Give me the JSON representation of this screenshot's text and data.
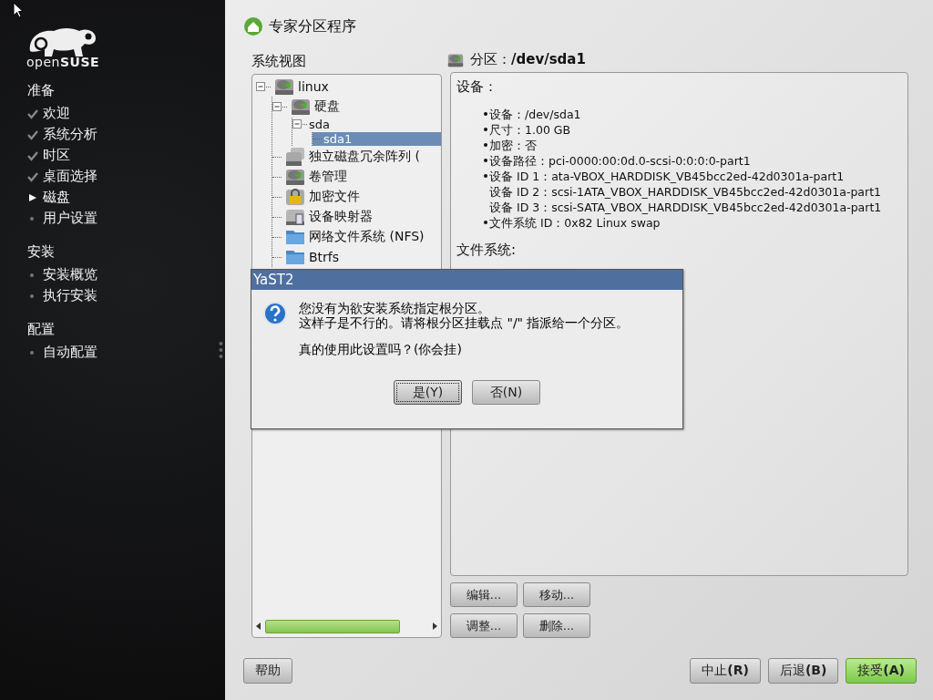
{
  "sidebar": {
    "logo_text": "open**SUSE**",
    "sections": [
      {
        "heading": "准备",
        "steps": [
          {
            "label": "欢迎",
            "completed": true,
            "current": false
          },
          {
            "label": "系统分析",
            "completed": true,
            "current": false
          },
          {
            "label": "时区",
            "completed": true,
            "current": false
          },
          {
            "label": "桌面选择",
            "completed": true,
            "current": false
          },
          {
            "label": "磁盘",
            "completed": false,
            "current": true
          },
          {
            "label": "用户设置",
            "completed": false,
            "current": false
          }
        ]
      },
      {
        "heading": "安装",
        "steps": [
          {
            "label": "安装概览",
            "completed": false,
            "current": false
          },
          {
            "label": "执行安装",
            "completed": false,
            "current": false
          }
        ]
      },
      {
        "heading": "配置",
        "steps": [
          {
            "label": "自动配置",
            "completed": false,
            "current": false
          }
        ]
      }
    ]
  },
  "header": {
    "title": "专家分区程序"
  },
  "system_view": {
    "label": "系统视图",
    "tree": [
      {
        "label": "linux",
        "kind": "disk",
        "selected": false,
        "expanded": true,
        "children": [
          {
            "label": "硬盘",
            "kind": "disk",
            "selected": false,
            "expanded": true,
            "children": [
              {
                "label": "sda",
                "selected": false,
                "expanded": true,
                "children": [
                  {
                    "label": "sda1",
                    "selected": true
                  }
                ]
              }
            ]
          },
          {
            "label": "独立磁盘冗余阵列 (",
            "kind": "raid",
            "selected": false
          },
          {
            "label": "卷管理",
            "kind": "disk",
            "selected": false
          },
          {
            "label": "加密文件",
            "kind": "lock",
            "selected": false
          },
          {
            "label": "设备映射器",
            "kind": "mapper",
            "selected": false
          },
          {
            "label": "网络文件系统 (NFS)",
            "kind": "folder",
            "selected": false
          },
          {
            "label": "Btrfs",
            "kind": "folder",
            "selected": false
          }
        ]
      }
    ]
  },
  "partition": {
    "title": "分区：**/dev/sda1**",
    "device_heading": "设备：",
    "items": [
      {
        "text": "设备：/dev/sda1",
        "bullet": true
      },
      {
        "text": "尺寸：1.00 GB",
        "bullet": true
      },
      {
        "text": "加密：否",
        "bullet": true
      },
      {
        "text": "设备路径：pci-0000:00:0d.0-scsi-0:0:0:0-part1",
        "bullet": true
      },
      {
        "text": "设备 ID 1：ata-VBOX_HARDDISK_VB45bcc2ed-42d0301a-part1",
        "bullet": true
      },
      {
        "text": "设备 ID 2：scsi-1ATA_VBOX_HARDDISK_VB45bcc2ed-42d0301a-part1",
        "bullet": false
      },
      {
        "text": "设备 ID 3：scsi-SATA_VBOX_HARDDISK_VB45bcc2ed-42d0301a-part1",
        "bullet": false
      },
      {
        "text": "文件系统 ID：0x82 Linux swap",
        "bullet": true
      }
    ],
    "filesystem_heading": "文件系统:",
    "actions": [
      "编辑...",
      "移动...",
      "调整...",
      "删除..."
    ]
  },
  "footer": {
    "help": "帮助",
    "buttons": [
      {
        "label": "中止**(R)**",
        "primary": false
      },
      {
        "label": "后退**(B)**",
        "primary": false
      },
      {
        "label": "接受**(A)**",
        "primary": true
      }
    ]
  },
  "dialog": {
    "title": "YaST2",
    "message": [
      "您没有为欲安装系统指定根分区。",
      "这样子是不行的。请将根分区挂载点 \"/\" 指派给一个分区。"
    ],
    "question": "真的使用此设置吗？(你会挂)",
    "buttons": [
      {
        "label": "是(Y)",
        "focused": true
      },
      {
        "label": "否(N)",
        "focused": false
      }
    ]
  }
}
